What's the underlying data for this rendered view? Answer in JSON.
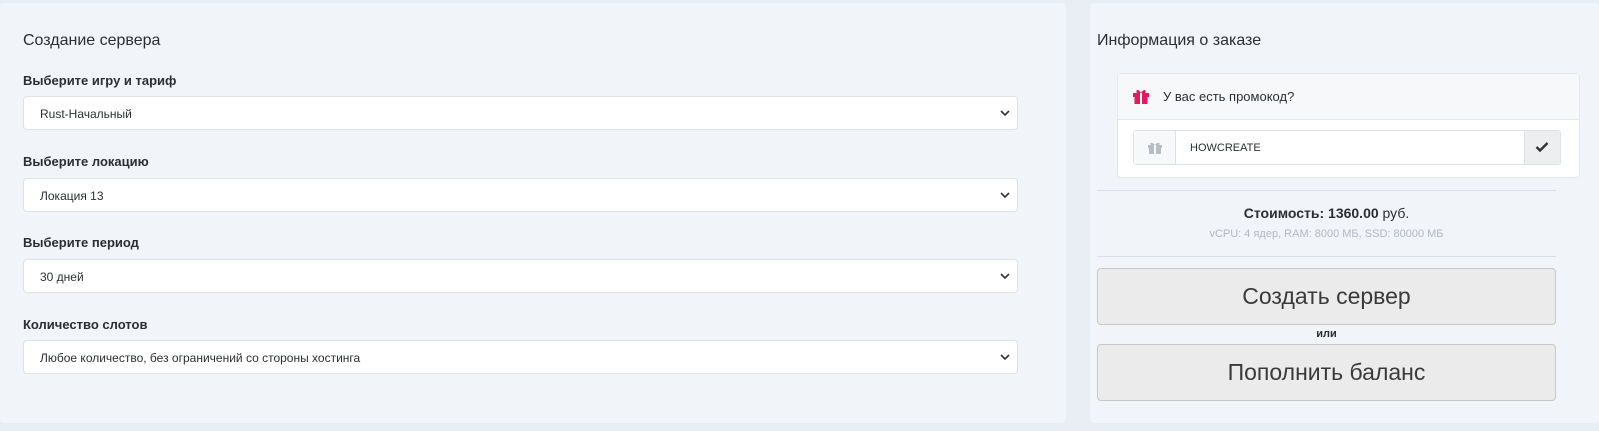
{
  "left": {
    "title": "Создание сервера",
    "fields": [
      {
        "label": "Выберите игру и тариф",
        "value": "Rust-Начальный"
      },
      {
        "label": "Выберите локацию",
        "value": "Локация 13"
      },
      {
        "label": "Выберите период",
        "value": "30 дней"
      },
      {
        "label": "Количество слотов",
        "value": "Любое количество, без ограничений со стороны хостинга"
      }
    ]
  },
  "right": {
    "title": "Информация о заказе",
    "promo": {
      "question": "У вас есть промокод?",
      "code": "HOWCREATE",
      "icon_head": "gift-icon",
      "icon_addon": "gift-icon",
      "icon_apply": "check-icon",
      "accent": "#e6195a"
    },
    "cost_label": "Стоимость:",
    "cost_value": "1360.00",
    "cost_unit": "руб.",
    "specs": "vCPU: 4 ядер, RAM: 8000 МБ, SSD: 80000 МБ",
    "create_button": "Создать сервер",
    "or_text": "или",
    "topup_button": "Пополнить баланс"
  }
}
